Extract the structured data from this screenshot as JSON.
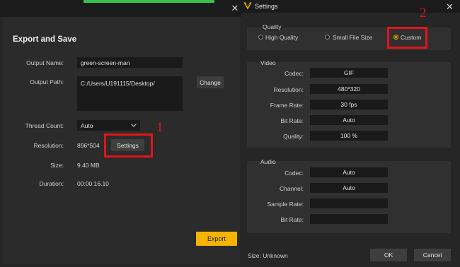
{
  "export_dialog": {
    "title": "Export and Save",
    "close_glyph": "✕",
    "output_name_label": "Output Name:",
    "output_name_value": "green-screen-man",
    "output_path_label": "Output Path:",
    "output_path_value": "C:/Users/U191115/Desktop/",
    "change_button": "Change",
    "thread_count_label": "Thread Count:",
    "thread_count_value": "Auto",
    "resolution_label": "Resolution:",
    "resolution_value": "896*504",
    "settings_button": "Settings",
    "size_label": "Size:",
    "size_value": "9.40 MB",
    "duration_label": "Duration:",
    "duration_value": "00:00:16.10",
    "export_button": "Export",
    "annotation_number": "1"
  },
  "settings_dialog": {
    "title": "Settings",
    "close_glyph": "✕",
    "logo_icon": "m-logo-icon",
    "quality": {
      "group_title": "Quality",
      "options": [
        "High Quality",
        "Small File Size",
        "Custom"
      ],
      "selected": "Custom",
      "annotation_number": "2"
    },
    "video": {
      "group_title": "Video",
      "rows": [
        {
          "label": "Codec:",
          "value": "GIF"
        },
        {
          "label": "Resolution:",
          "value": "480*320"
        },
        {
          "label": "Frame Rate:",
          "value": "30 fps"
        },
        {
          "label": "Bit Rate:",
          "value": "Auto"
        },
        {
          "label": "Quality:",
          "value": "100 %"
        }
      ]
    },
    "audio": {
      "group_title": "Audio",
      "rows": [
        {
          "label": "Codec:",
          "value": "Auto"
        },
        {
          "label": "Channel:",
          "value": "Auto"
        },
        {
          "label": "Sample Rate:",
          "value": ""
        },
        {
          "label": "Bit Rate:",
          "value": ""
        }
      ]
    },
    "size_text": "Size: Unknown",
    "ok_button": "OK",
    "cancel_button": "Cancel"
  },
  "colors": {
    "accent": "#f5b400",
    "annotation_red": "#e3141b",
    "top_green": "#36c24a"
  }
}
